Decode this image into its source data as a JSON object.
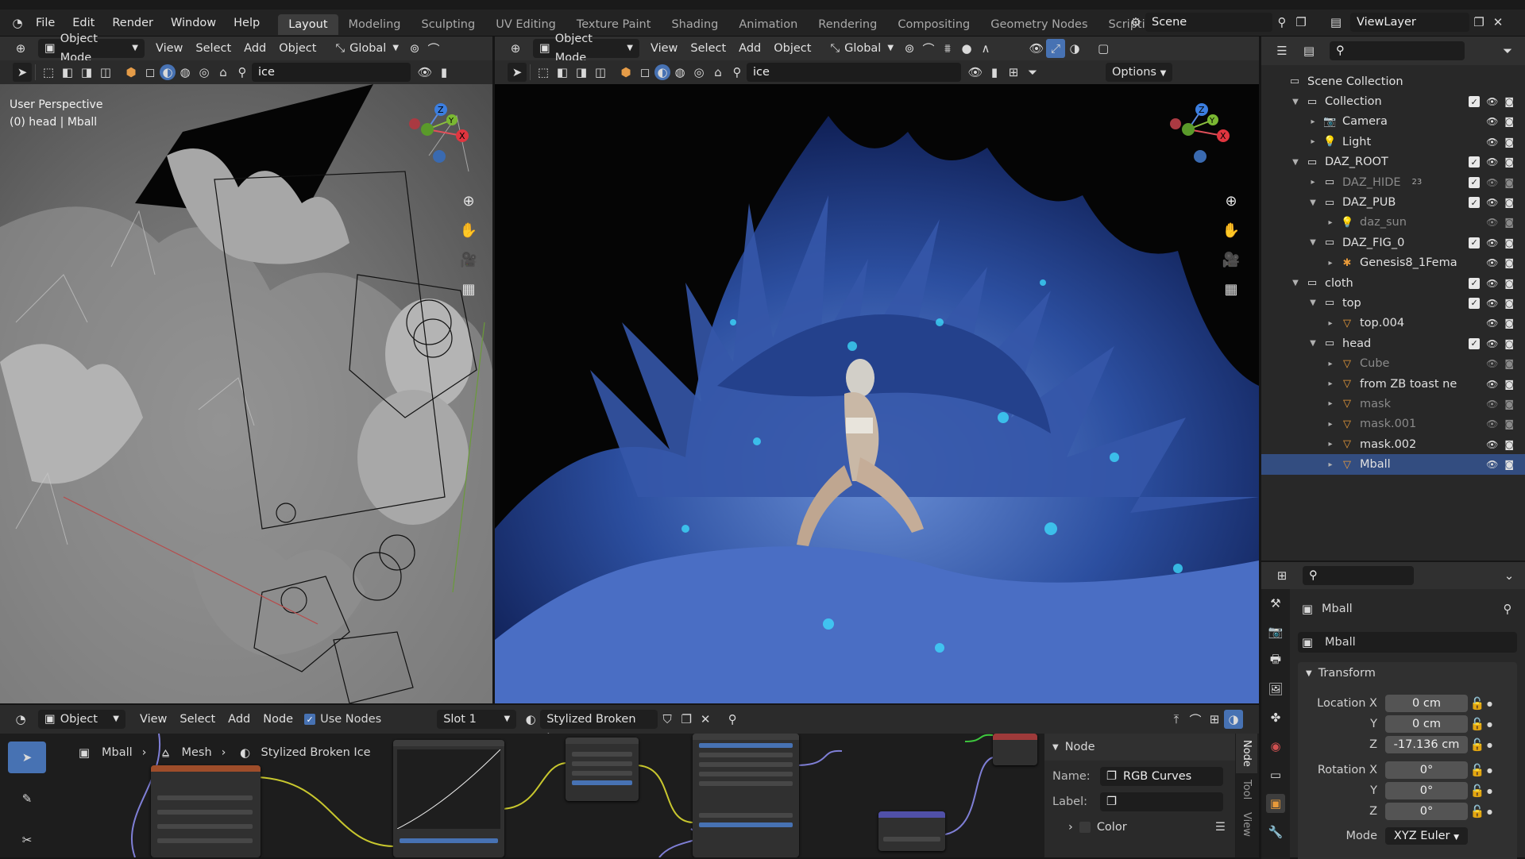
{
  "menus": [
    "File",
    "Edit",
    "Render",
    "Window",
    "Help"
  ],
  "workspaces": [
    {
      "label": "Layout",
      "active": true
    },
    {
      "label": "Modeling"
    },
    {
      "label": "Sculpting"
    },
    {
      "label": "UV Editing"
    },
    {
      "label": "Texture Paint"
    },
    {
      "label": "Shading"
    },
    {
      "label": "Animation"
    },
    {
      "label": "Rendering"
    },
    {
      "label": "Compositing"
    },
    {
      "label": "Geometry Nodes"
    },
    {
      "label": "Scripting"
    }
  ],
  "scene": {
    "label": "Scene"
  },
  "viewlayer": {
    "label": "ViewLayer"
  },
  "viewportL": {
    "mode": "Object Mode",
    "menu": [
      "View",
      "Select",
      "Add",
      "Object"
    ],
    "orientation": "Global",
    "search": "ice",
    "overlay_title": "User Perspective",
    "overlay_sub": "(0) head | Mball"
  },
  "viewportR": {
    "mode": "Object Mode",
    "menu": [
      "View",
      "Select",
      "Add",
      "Object"
    ],
    "orientation": "Global",
    "search": "ice",
    "options": "Options"
  },
  "gizmo": {
    "x": "X",
    "y": "Y",
    "z": "Z"
  },
  "outliner": {
    "rows": [
      {
        "label": "Scene Collection",
        "indent": 0,
        "tri": "",
        "type": "scene",
        "vis": false
      },
      {
        "label": "Collection",
        "indent": 1,
        "tri": "▼",
        "type": "coll",
        "vis": true,
        "check": true
      },
      {
        "label": "Camera",
        "indent": 2,
        "tri": "▸",
        "type": "camera",
        "vis": true
      },
      {
        "label": "Light",
        "indent": 2,
        "tri": "▸",
        "type": "light",
        "vis": true
      },
      {
        "label": "DAZ_ROOT",
        "indent": 1,
        "tri": "▼",
        "type": "coll",
        "vis": true,
        "check": true
      },
      {
        "label": "DAZ_HIDE",
        "indent": 2,
        "tri": "▸",
        "type": "coll",
        "vis": true,
        "check": true,
        "dim": true,
        "badge": "23"
      },
      {
        "label": "DAZ_PUB",
        "indent": 2,
        "tri": "▼",
        "type": "coll",
        "vis": true,
        "check": true
      },
      {
        "label": "daz_sun",
        "indent": 3,
        "tri": "▸",
        "type": "light",
        "vis": true,
        "dim": true
      },
      {
        "label": "DAZ_FIG_0",
        "indent": 2,
        "tri": "▼",
        "type": "coll",
        "vis": true,
        "check": true
      },
      {
        "label": "Genesis8_1Fema",
        "indent": 3,
        "tri": "▸",
        "type": "armature",
        "vis": true
      },
      {
        "label": "cloth",
        "indent": 1,
        "tri": "▼",
        "type": "coll",
        "vis": true,
        "check": true
      },
      {
        "label": "top",
        "indent": 2,
        "tri": "▼",
        "type": "coll",
        "vis": true,
        "check": true
      },
      {
        "label": "top.004",
        "indent": 3,
        "tri": "▸",
        "type": "mesh",
        "vis": true
      },
      {
        "label": "head",
        "indent": 2,
        "tri": "▼",
        "type": "coll",
        "vis": true,
        "check": true
      },
      {
        "label": "Cube",
        "indent": 3,
        "tri": "▸",
        "type": "mesh",
        "vis": true,
        "dim": true
      },
      {
        "label": "from ZB toast ne",
        "indent": 3,
        "tri": "▸",
        "type": "mesh",
        "vis": true
      },
      {
        "label": "mask",
        "indent": 3,
        "tri": "▸",
        "type": "mesh",
        "vis": true,
        "dim": true
      },
      {
        "label": "mask.001",
        "indent": 3,
        "tri": "▸",
        "type": "mesh",
        "vis": true,
        "dim": true
      },
      {
        "label": "mask.002",
        "indent": 3,
        "tri": "▸",
        "type": "mesh",
        "vis": true
      },
      {
        "label": "Mball",
        "indent": 3,
        "tri": "▸",
        "type": "mesh",
        "vis": true,
        "selected": true
      }
    ]
  },
  "props": {
    "object_name": "Mball",
    "data_name": "Mball",
    "panel": "Transform",
    "location": {
      "label": "Location X",
      "x": "0 cm",
      "y": "0 cm",
      "z": "-17.136 cm"
    },
    "rotation": {
      "label": "Rotation X",
      "x": "0°",
      "y": "0°",
      "z": "0°"
    },
    "axis": {
      "y": "Y",
      "z": "Z"
    },
    "mode_label": "Mode",
    "mode": "XYZ Euler"
  },
  "nodeEditor": {
    "type": "Object",
    "menu": [
      "View",
      "Select",
      "Add",
      "Node"
    ],
    "use_nodes": "Use Nodes",
    "slot": "Slot 1",
    "material": "Stylized Broken Ice",
    "breadcrumb": [
      "Mball",
      "Mesh",
      "Stylized Broken Ice"
    ],
    "sidebar": {
      "title": "Node",
      "name_label": "Name:",
      "name": "RGB Curves",
      "label_label": "Label:",
      "color": "Color"
    },
    "tabs": [
      "Node",
      "Tool",
      "View"
    ]
  }
}
